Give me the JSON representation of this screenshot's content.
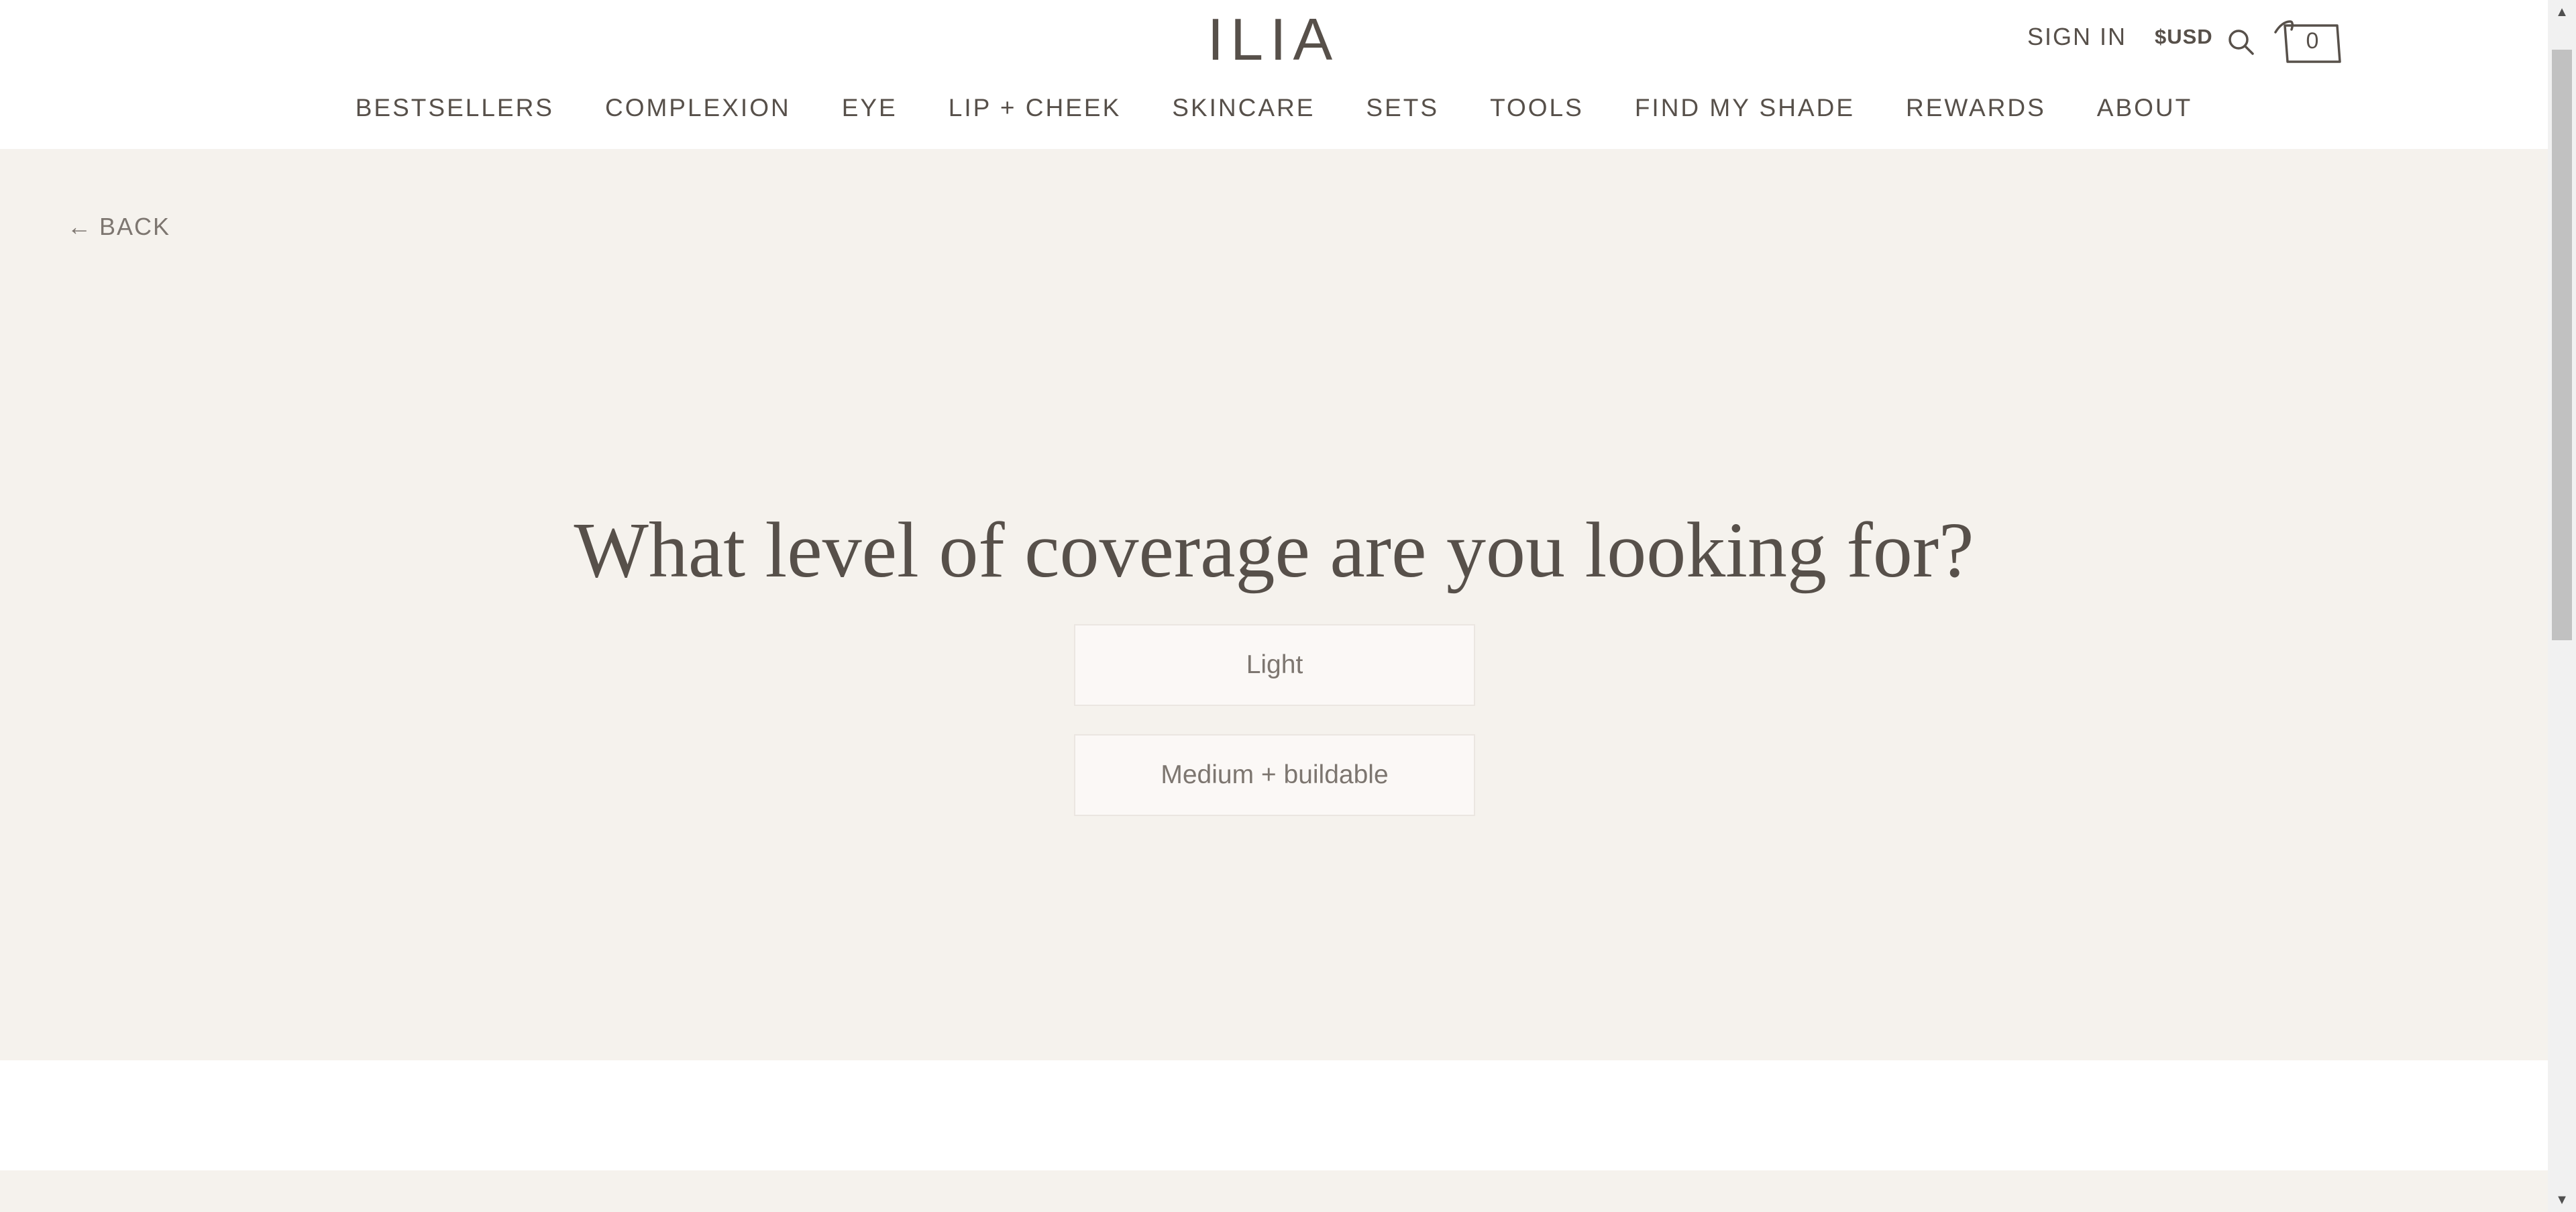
{
  "header": {
    "logo": "ILIA",
    "sign_in": "SIGN IN",
    "currency": "$USD",
    "cart_count": "0",
    "icons": [
      "search-icon",
      "cart-icon"
    ]
  },
  "nav": {
    "items": [
      {
        "label": "BESTSELLERS"
      },
      {
        "label": "COMPLEXION"
      },
      {
        "label": "EYE"
      },
      {
        "label": "LIP + CHEEK"
      },
      {
        "label": "SKINCARE"
      },
      {
        "label": "SETS"
      },
      {
        "label": "TOOLS"
      },
      {
        "label": "FIND MY SHADE"
      },
      {
        "label": "REWARDS"
      },
      {
        "label": "ABOUT"
      }
    ]
  },
  "quiz": {
    "back_arrow": "←",
    "back_label": "BACK",
    "question": "What level of coverage are you looking for?",
    "options": [
      {
        "label": "Light"
      },
      {
        "label": "Medium + buildable"
      }
    ]
  },
  "colors": {
    "text": "#57504a",
    "muted_text": "#7d7670",
    "section_bg": "#f5f2ed",
    "option_bg": "#fbf8f6",
    "option_border": "#ebe6e1"
  }
}
